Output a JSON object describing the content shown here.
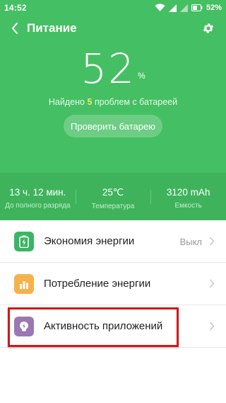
{
  "status_bar": {
    "time": "14:52",
    "battery_percent": "52%",
    "icons": [
      "wifi-icon",
      "signal-icon",
      "signal-icon",
      "battery-icon"
    ]
  },
  "header": {
    "title": "Питание",
    "back_icon": "chevron-left-icon",
    "settings_icon": "gear-icon"
  },
  "battery": {
    "level": "52",
    "unit": "%",
    "problems_prefix": "Найдено",
    "problems_count": "5",
    "problems_suffix": "проблем с батареей",
    "check_button": "Проверить батарею"
  },
  "stats": [
    {
      "value": "13 ч. 12 мин.",
      "label": "До полного разряда"
    },
    {
      "value": "25℃",
      "label": "Температура"
    },
    {
      "value": "3120 mAh",
      "label": "Емкость"
    }
  ],
  "menu": [
    {
      "label": "Экономия энергии",
      "value": "Выкл",
      "icon": "battery-saver-icon",
      "icon_color": "#3bb564"
    },
    {
      "label": "Потребление энергии",
      "value": "",
      "icon": "bar-chart-icon",
      "icon_color": "#f6b24a"
    },
    {
      "label": "Активность приложений",
      "value": "",
      "icon": "app-activity-icon",
      "icon_color": "#9a78b4"
    }
  ],
  "colors": {
    "header_green": "#45bf63",
    "stats_green": "#3fb35b",
    "highlight_red": "#d0181c"
  }
}
